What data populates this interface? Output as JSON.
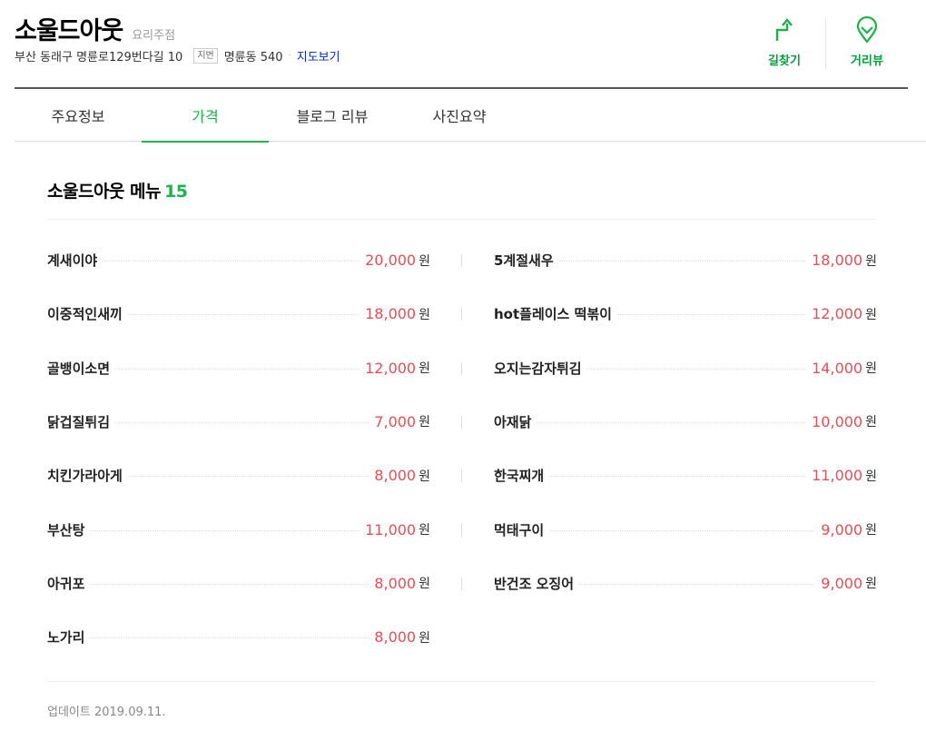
{
  "place": {
    "name": "소울드아웃",
    "category": "요리주점",
    "address": "부산 동래구 명륜로129번다길 10",
    "jibun_badge": "지번",
    "jibun_address": "명륜동 540",
    "map_link": "지도보기"
  },
  "actions": [
    {
      "label": "길찾기",
      "icon": "directions-arrow-icon"
    },
    {
      "label": "거리뷰",
      "icon": "street-view-pin-icon"
    }
  ],
  "tabs": [
    {
      "label": "주요정보",
      "active": false
    },
    {
      "label": "가격",
      "active": true
    },
    {
      "label": "블로그 리뷰",
      "active": false
    },
    {
      "label": "사진요약",
      "active": false
    }
  ],
  "menu": {
    "title": "소울드아웃 메뉴",
    "count": "15",
    "currency": "원",
    "left": [
      {
        "name": "계새이야",
        "price": "20,000"
      },
      {
        "name": "이중적인새끼",
        "price": "18,000"
      },
      {
        "name": "골뱅이소면",
        "price": "12,000"
      },
      {
        "name": "닭겁질튀김",
        "price": "7,000"
      },
      {
        "name": "치킨가라아게",
        "price": "8,000"
      },
      {
        "name": "부산탕",
        "price": "11,000"
      },
      {
        "name": "아귀포",
        "price": "8,000"
      },
      {
        "name": "노가리",
        "price": "8,000"
      }
    ],
    "right": [
      {
        "name": "5계절새우",
        "price": "18,000"
      },
      {
        "name": "hot플레이스 떡볶이",
        "price": "12,000"
      },
      {
        "name": "오지는감자튀김",
        "price": "14,000"
      },
      {
        "name": "아재닭",
        "price": "10,000"
      },
      {
        "name": "한국찌개",
        "price": "11,000"
      },
      {
        "name": "먹태구이",
        "price": "9,000"
      },
      {
        "name": "반건조 오징어",
        "price": "9,000"
      }
    ]
  },
  "update": "업데이트 2019.09.11.",
  "colors": {
    "accent": "#1bb34a",
    "price": "#ee4b52",
    "link": "#0d2bb5"
  }
}
